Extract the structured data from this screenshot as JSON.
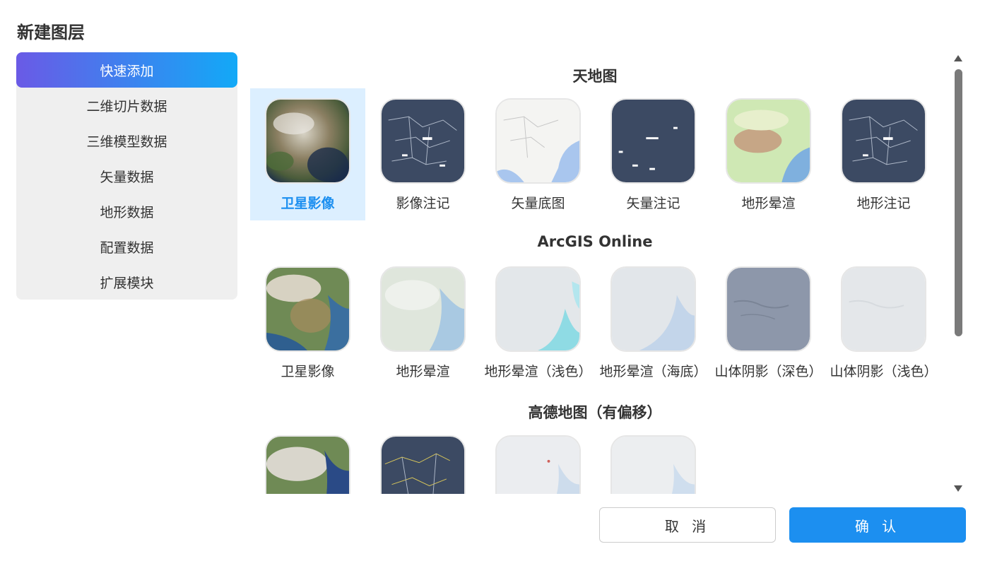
{
  "dialog": {
    "title": "新建图层"
  },
  "sidebar": {
    "items": [
      {
        "label": "快速添加",
        "active": true
      },
      {
        "label": "二维切片数据",
        "active": false
      },
      {
        "label": "三维模型数据",
        "active": false
      },
      {
        "label": "矢量数据",
        "active": false
      },
      {
        "label": "地形数据",
        "active": false
      },
      {
        "label": "配置数据",
        "active": false
      },
      {
        "label": "扩展模块",
        "active": false
      }
    ]
  },
  "groups": [
    {
      "title": "天地图",
      "items": [
        {
          "label": "卫星影像",
          "thumb": "satellite-map-icon",
          "selected": true
        },
        {
          "label": "影像注记",
          "thumb": "dark-annotation-map-icon"
        },
        {
          "label": "矢量底图",
          "thumb": "vector-base-map-icon"
        },
        {
          "label": "矢量注记",
          "thumb": "dark-label-map-icon"
        },
        {
          "label": "地形晕渲",
          "thumb": "terrain-shading-map-icon"
        },
        {
          "label": "地形注记",
          "thumb": "dark-annotation-map-icon"
        }
      ]
    },
    {
      "title": "ArcGIS Online",
      "items": [
        {
          "label": "卫星影像",
          "thumb": "satellite-map-icon"
        },
        {
          "label": "地形晕渲",
          "thumb": "terrain-map-icon"
        },
        {
          "label": "地形晕渲（浅色）",
          "thumb": "light-terrain-map-icon"
        },
        {
          "label": "地形晕渲（海底）",
          "thumb": "ocean-terrain-map-icon"
        },
        {
          "label": "山体阴影（深色）",
          "thumb": "dark-hillshade-map-icon"
        },
        {
          "label": "山体阴影（浅色）",
          "thumb": "light-hillshade-map-icon"
        }
      ]
    },
    {
      "title": "高德地图（有偏移）",
      "items": [
        {
          "label": "",
          "thumb": "satellite-map-icon"
        },
        {
          "label": "",
          "thumb": "dark-road-map-icon"
        },
        {
          "label": "",
          "thumb": "light-road-map-icon"
        },
        {
          "label": "",
          "thumb": "light-base-map-icon"
        }
      ]
    }
  ],
  "buttons": {
    "cancel": "取 消",
    "confirm": "确 认"
  },
  "colors": {
    "primary": "#1c8ff0",
    "gradient_start": "#6a5ae6",
    "gradient_end": "#12a9f7",
    "selected_bg": "#dcefff"
  }
}
